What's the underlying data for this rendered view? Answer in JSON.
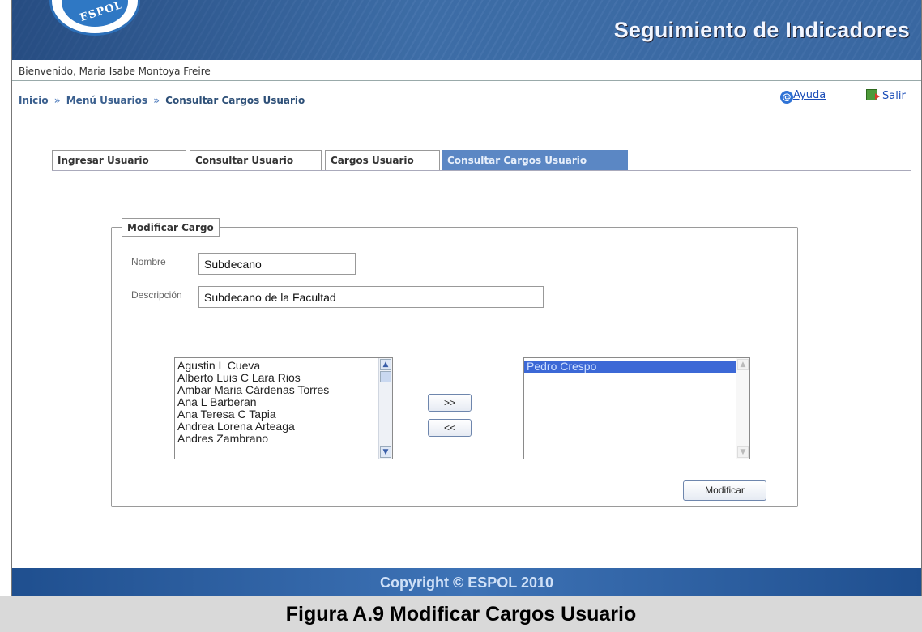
{
  "header": {
    "logo_text": "ESPOL",
    "site_title": "Seguimiento de Indicadores"
  },
  "welcome": "Bienvenido, Maria Isabe Montoya Freire",
  "breadcrumb": {
    "items": [
      "Inicio",
      "Menú Usuarios",
      "Consultar Cargos Usuario"
    ],
    "separator": "»"
  },
  "util_links": {
    "help": "Ayuda",
    "exit": "Salir"
  },
  "tabs": [
    {
      "label": "Ingresar Usuario",
      "active": false
    },
    {
      "label": "Consultar Usuario",
      "active": false
    },
    {
      "label": "Cargos Usuario",
      "active": false
    },
    {
      "label": "Consultar Cargos Usuario",
      "active": true
    }
  ],
  "form": {
    "legend": "Modificar Cargo",
    "nombre_label": "Nombre",
    "nombre_value": "Subdecano",
    "descripcion_label": "Descripción",
    "descripcion_value": "Subdecano de la Facultad"
  },
  "available_users": [
    "Agustin L Cueva",
    "Alberto Luis C Lara Rios",
    "Ambar Maria Cárdenas Torres",
    "Ana L Barberan",
    "Ana Teresa C Tapia",
    "Andrea Lorena Arteaga",
    "Andres Zambrano"
  ],
  "assigned_users": [
    "Pedro Crespo"
  ],
  "buttons": {
    "add": ">>",
    "remove": "<<",
    "modify": "Modificar"
  },
  "footer": "Copyright © ESPOL 2010",
  "caption": "Figura A.9 Modificar Cargos Usuario",
  "colors": {
    "header_blue": "#3f6ea8",
    "active_tab": "#5b87c4",
    "selected_item": "#3c68d6"
  }
}
